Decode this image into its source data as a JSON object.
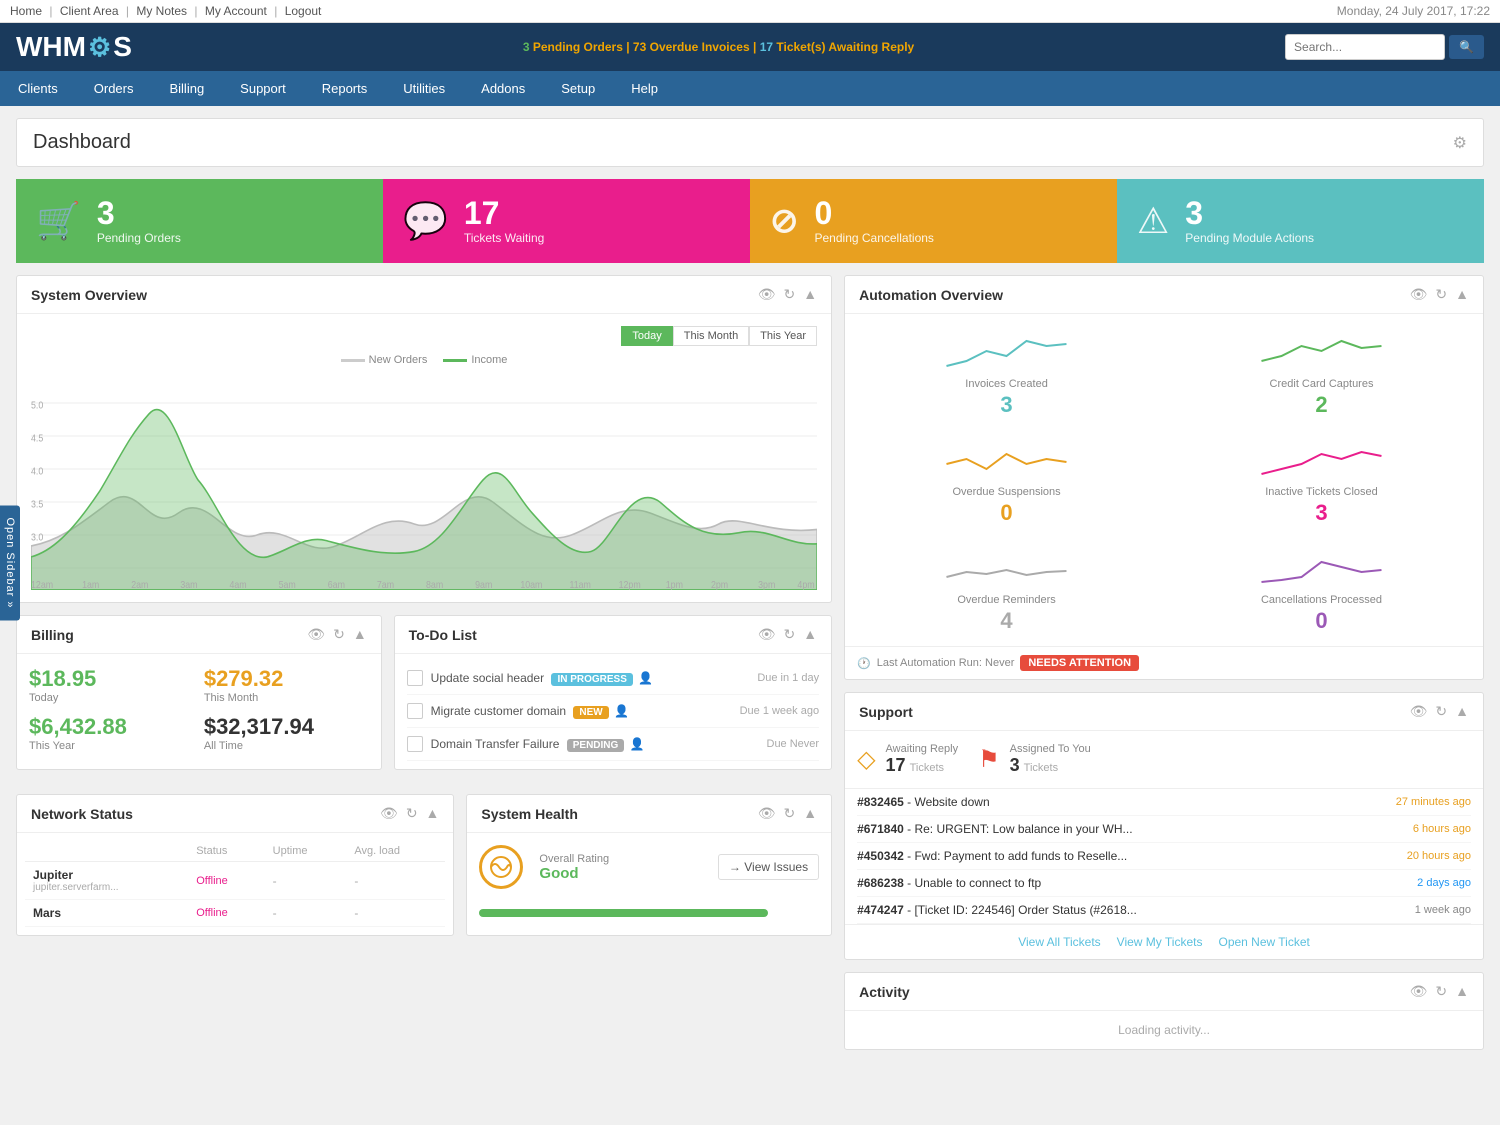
{
  "topbar": {
    "links": [
      "Home",
      "Client Area",
      "My Notes",
      "My Account",
      "Logout"
    ],
    "datetime": "Monday, 24 July 2017, 17:22"
  },
  "header": {
    "logo": "WHMC S",
    "alerts": {
      "pending_orders": "3",
      "pending_orders_label": "Pending Orders",
      "overdue_invoices": "73",
      "overdue_invoices_label": "Overdue Invoices",
      "tickets_awaiting": "17",
      "tickets_awaiting_label": "Ticket(s) Awaiting Reply"
    },
    "search_placeholder": "Search..."
  },
  "nav": {
    "items": [
      "Clients",
      "Orders",
      "Billing",
      "Support",
      "Reports",
      "Utilities",
      "Addons",
      "Setup",
      "Help"
    ]
  },
  "dashboard": {
    "title": "Dashboard",
    "stat_cards": [
      {
        "num": "3",
        "label": "Pending Orders",
        "color": "green",
        "icon": "🛒"
      },
      {
        "num": "17",
        "label": "Tickets Waiting",
        "color": "pink",
        "icon": "💬"
      },
      {
        "num": "0",
        "label": "Pending Cancellations",
        "color": "orange",
        "icon": "⊘"
      },
      {
        "num": "3",
        "label": "Pending Module Actions",
        "color": "teal",
        "icon": "⚠"
      }
    ],
    "system_overview": {
      "title": "System Overview",
      "chart_buttons": [
        "Today",
        "This Month",
        "This Year"
      ],
      "active_btn": "Today",
      "legend": [
        "New Orders",
        "Income"
      ]
    },
    "automation": {
      "title": "Automation Overview",
      "items": [
        {
          "label": "Invoices Created",
          "num": "3",
          "color": "teal",
          "chart_color": "#5bc0c0"
        },
        {
          "label": "Credit Card Captures",
          "num": "2",
          "color": "green",
          "chart_color": "#5cb85c"
        },
        {
          "label": "Overdue Suspensions",
          "num": "0",
          "color": "orange",
          "chart_color": "#e8a020"
        },
        {
          "label": "Inactive Tickets Closed",
          "num": "3",
          "color": "pink",
          "chart_color": "#e91e8c"
        },
        {
          "label": "Overdue Reminders",
          "num": "4",
          "color": "gray",
          "chart_color": "#aaa"
        },
        {
          "label": "Cancellations Processed",
          "num": "0",
          "color": "purple",
          "chart_color": "#9b59b6"
        }
      ],
      "footer": "Last Automation Run: Never",
      "needs_attention": "NEEDS ATTENTION"
    },
    "billing": {
      "title": "Billing",
      "items": [
        {
          "label": "Today",
          "value": "$18.95",
          "color": "green"
        },
        {
          "label": "This Month",
          "value": "$279.32",
          "color": "orange"
        },
        {
          "label": "This Year",
          "value": "$6,432.88",
          "color": "green"
        },
        {
          "label": "All Time",
          "value": "$32,317.94",
          "color": "black"
        }
      ]
    },
    "todo": {
      "title": "To-Do List",
      "items": [
        {
          "text": "Update social header",
          "badge": "IN PROGRESS",
          "badge_type": "in-progress",
          "due": "Due in 1 day"
        },
        {
          "text": "Migrate customer domain",
          "badge": "NEW",
          "badge_type": "new",
          "due": "Due 1 week ago"
        },
        {
          "text": "Domain Transfer Failure",
          "badge": "PENDING",
          "badge_type": "pending",
          "due": "Due Never"
        }
      ]
    },
    "network": {
      "title": "Network Status",
      "headers": [
        "",
        "Status",
        "Uptime",
        "Avg. load"
      ],
      "items": [
        {
          "name": "Jupiter",
          "sub": "jupiter.serverfarm...",
          "status": "Offline",
          "uptime": "-",
          "load": "-"
        },
        {
          "name": "Mars",
          "sub": "",
          "status": "Offline",
          "uptime": "-",
          "load": "-"
        }
      ]
    },
    "support": {
      "title": "Support",
      "awaiting": {
        "label": "Awaiting Reply",
        "num": "17",
        "sub": "Tickets"
      },
      "assigned": {
        "label": "Assigned To You",
        "num": "3",
        "sub": "Tickets"
      },
      "tickets": [
        {
          "id": "#832465",
          "text": " - Website down",
          "time": "27 minutes ago",
          "time_color": "orange"
        },
        {
          "id": "#671840",
          "text": " - Re: URGENT: Low balance in your WH...",
          "time": "6 hours ago",
          "time_color": "orange"
        },
        {
          "id": "#450342",
          "text": " - Fwd: Payment to add funds to Reselle...",
          "time": "20 hours ago",
          "time_color": "orange"
        },
        {
          "id": "#686238",
          "text": " - Unable to connect to ftp",
          "time": "2 days ago",
          "time_color": "blue"
        },
        {
          "id": "#474247",
          "text": " - [Ticket ID: 224546] Order Status (#2618...",
          "time": "1 week ago",
          "time_color": "gray"
        }
      ],
      "footer_links": [
        "View All Tickets",
        "View My Tickets",
        "Open New Ticket"
      ]
    },
    "system_health": {
      "title": "System Health",
      "overall_label": "Overall Rating",
      "overall_value": "Good",
      "btn": "→ View Issues"
    },
    "activity": {
      "title": "Activity"
    }
  }
}
